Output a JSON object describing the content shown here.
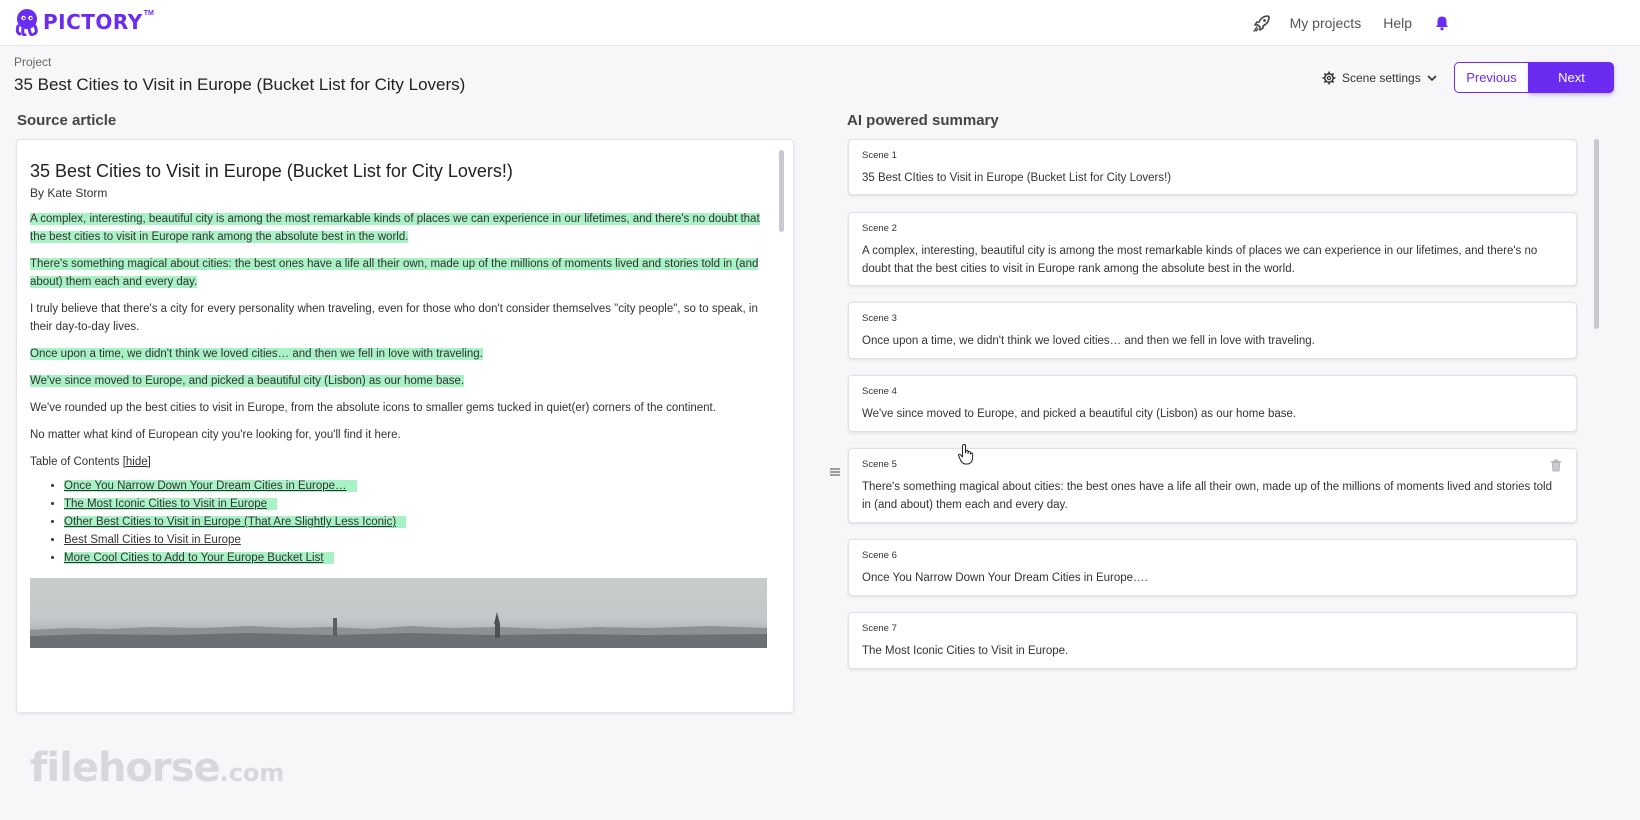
{
  "app": {
    "logo_text": "PICTORY",
    "logo_tm": "TM"
  },
  "nav": {
    "my_projects": "My projects",
    "help": "Help"
  },
  "project": {
    "label": "Project",
    "title": "35 Best Cities to Visit in Europe (Bucket List for City Lovers)"
  },
  "toolbar": {
    "scene_settings": "Scene settings",
    "previous": "Previous",
    "next": "Next"
  },
  "source": {
    "heading": "Source article",
    "article_title": "35 Best Cities to Visit in Europe (Bucket List for City Lovers!)",
    "byline": "By Kate Storm",
    "paragraphs": [
      {
        "text": "A complex, interesting, beautiful city is among the most remarkable kinds of places we can experience in our lifetimes, and there's no doubt that the best cities to visit in Europe rank among the absolute best in the world.",
        "highlighted": true
      },
      {
        "text": "There's something magical about cities: the best ones have a life all their own, made up of the millions of moments lived and stories told in (and about) them each and every day.",
        "highlighted": true
      },
      {
        "text": "I truly believe that there's a city for every personality when traveling, even for those who don't consider themselves \"city people\", so to speak, in their day-to-day lives.",
        "highlighted": false
      },
      {
        "text": "Once upon a time, we didn't think we loved cities… and then we fell in love with traveling.",
        "highlighted": true
      },
      {
        "text": "We've since moved to Europe, and picked a beautiful city (Lisbon) as our home base.",
        "highlighted": true
      },
      {
        "text": "We've rounded up the best cities to visit in Europe, from the absolute icons to smaller gems tucked in quiet(er) corners of the continent.",
        "highlighted": false
      },
      {
        "text": "No matter what kind of European city you're looking for, you'll find it here.",
        "highlighted": false
      }
    ],
    "toc_title": "Table of Contents [",
    "toc_hide": "hide",
    "toc_close": "]",
    "toc_items": [
      {
        "text": "Once You Narrow Down Your Dream Cities in Europe…",
        "highlighted": true
      },
      {
        "text": "The Most Iconic Cities to Visit in Europe",
        "highlighted": true
      },
      {
        "text": "Other Best Cities to Visit in Europe (That Are Slightly Less Iconic)",
        "highlighted": true
      },
      {
        "text": "Best Small Cities to Visit in Europe",
        "highlighted": false
      },
      {
        "text": "More Cool Cities to Add to Your Europe Bucket List",
        "highlighted": true
      }
    ]
  },
  "summary": {
    "heading": "AI powered summary",
    "scenes": [
      {
        "label": "Scene 1",
        "text": "35 Best CIties to Visit in Europe (Bucket List for City Lovers!)"
      },
      {
        "label": "Scene 2",
        "text": "A complex, interesting, beautiful city is among the most remarkable kinds of places we can experience in our lifetimes, and there's no doubt that the best cities to visit in Europe rank among the absolute best in the world."
      },
      {
        "label": "Scene 3",
        "text": "Once upon a time, we didn't think we loved cities… and then we fell in love with traveling."
      },
      {
        "label": "Scene 4",
        "text": "We've since moved to Europe, and picked a beautiful city (Lisbon) as our home base."
      },
      {
        "label": "Scene 5",
        "text": "There's something magical about cities: the best ones have a life all their own, made up of the millions of moments lived and stories told in (and about) them each and every day."
      },
      {
        "label": "Scene 6",
        "text": "Once You Narrow Down Your Dream Cities in Europe…."
      },
      {
        "label": "Scene 7",
        "text": "The Most Iconic Cities to Visit in Europe."
      }
    ]
  },
  "watermark": {
    "main": "filehorse",
    "suffix": ".com"
  },
  "colors": {
    "brand": "#6a2cf0",
    "highlight": "#a8f2c5",
    "bell": "#6a2cf0"
  },
  "icons": [
    "rocket-icon",
    "bell-icon",
    "gear-icon",
    "chevron-down-icon",
    "drag-handle-icon",
    "trash-icon",
    "hand-cursor-icon"
  ]
}
